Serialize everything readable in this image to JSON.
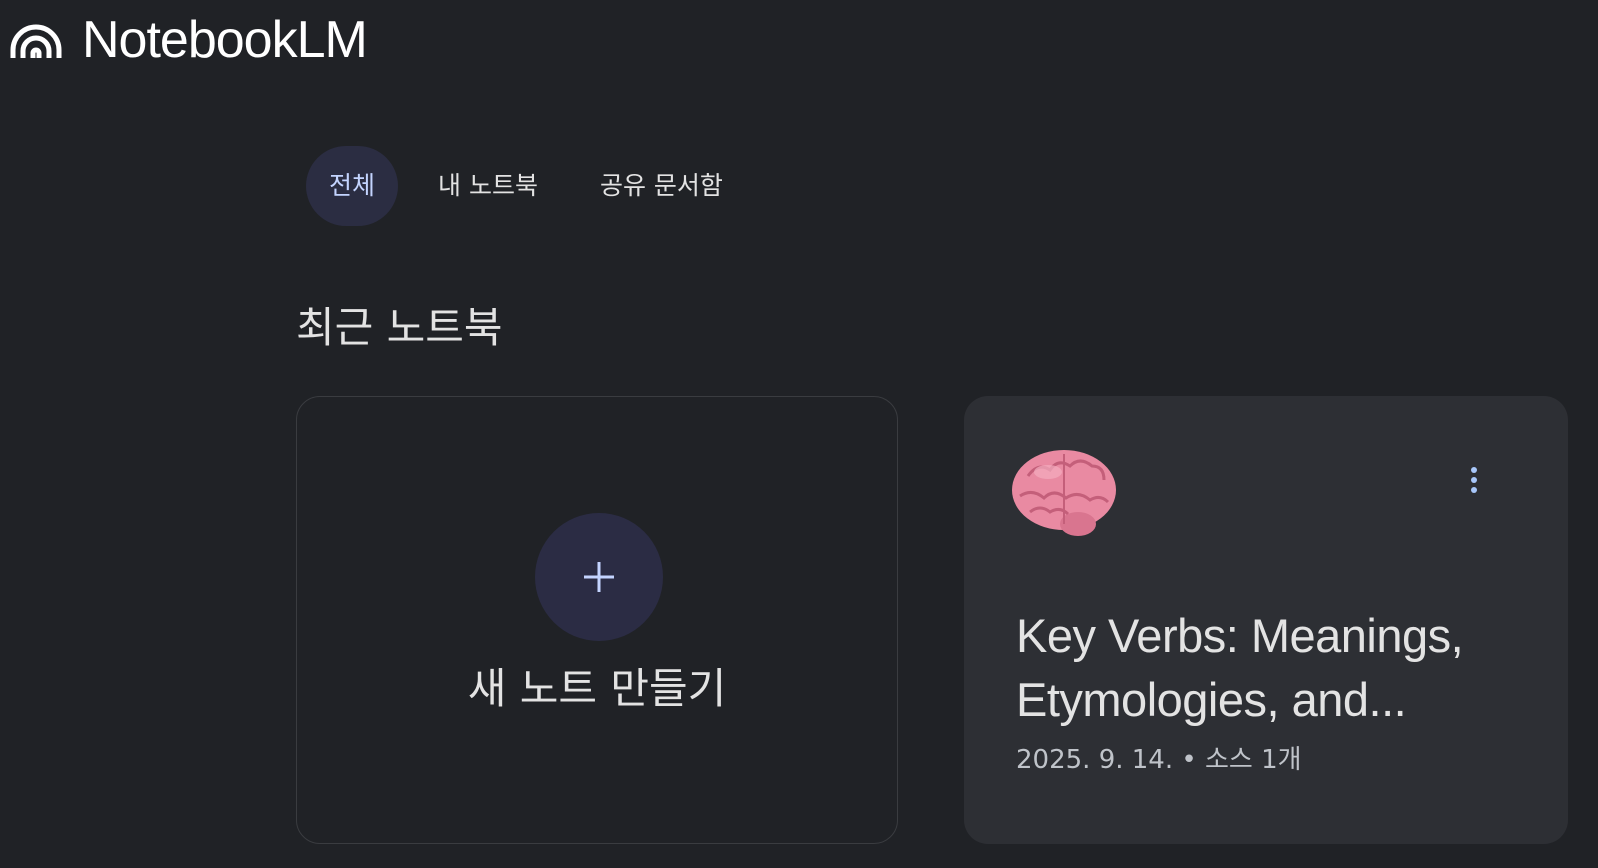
{
  "app": {
    "title": "NotebookLM",
    "logo_icon": "notebooklm-logo-icon"
  },
  "tabs": [
    {
      "label": "전체",
      "active": true
    },
    {
      "label": "내 노트북",
      "active": false
    },
    {
      "label": "공유 문서함",
      "active": false
    }
  ],
  "section": {
    "title": "최근 노트북"
  },
  "create_card": {
    "icon": "plus-icon",
    "label": "새 노트 만들기"
  },
  "notebooks": [
    {
      "emoji_icon": "brain-icon",
      "title": "Key Verbs: Meanings, Etymologies, and...",
      "date": "2025. 9. 14.",
      "separator": "•",
      "sources": "소스 1개",
      "menu_icon": "more-vert-icon"
    }
  ],
  "colors": {
    "background": "#202226",
    "active_tab_bg": "#2b2d42",
    "active_tab_text": "#c4d4ff",
    "card_bg": "#2d2f34",
    "plus_circle_bg": "#2b2c44",
    "accent": "#a8c7fa"
  }
}
